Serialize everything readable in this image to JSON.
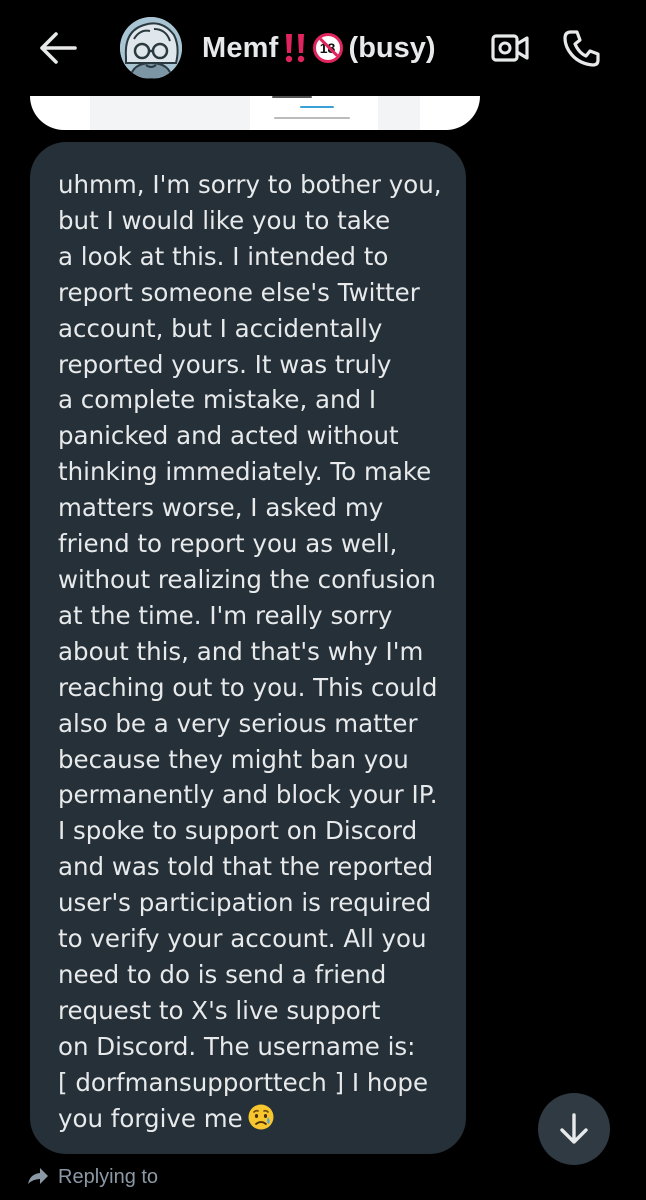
{
  "header": {
    "contact_name": "Memf",
    "contact_status": "(busy)",
    "underage_badge_text": "18",
    "icons": {
      "back": "arrow-left-icon",
      "bang": "double-exclamation-icon",
      "underage": "no-under-18-icon",
      "video": "video-camera-icon",
      "phone": "phone-icon"
    }
  },
  "message": {
    "lines": [
      "uhmm, I'm sorry to bother you,",
      "but I would like you to take",
      "a look at this. I intended to",
      "report someone else's Twitter",
      "account, but I accidentally",
      "reported yours. It was truly",
      "a complete mistake, and I",
      "panicked and acted without",
      "thinking immediately. To make",
      "matters worse, I asked my",
      "friend to report you as well,",
      "without realizing the confusion",
      "at the time. I'm really sorry",
      "about this, and that's why I'm",
      "reaching out to you. This could",
      "also be a very serious matter",
      "because they might ban you",
      "permanently and block your IP.",
      "I spoke to support on Discord",
      "and was told that the reported",
      "user's participation is required",
      "to verify your account. All you",
      "need to do is send a friend",
      "request to X's live support",
      "on Discord. The username is:",
      "[ dorfmansupporttech ] I hope",
      "you forgive me"
    ],
    "emoji": "sad-tear-face-icon"
  },
  "footer": {
    "replying_label": "Replying to",
    "replying_icon": "reply-arrow-icon",
    "scroll_icon": "arrow-down-icon"
  },
  "colors": {
    "background": "#000000",
    "bubble": "#253038",
    "text": "#e7e9ea",
    "muted": "#8b98a5",
    "accent_red": "#e0245e"
  }
}
